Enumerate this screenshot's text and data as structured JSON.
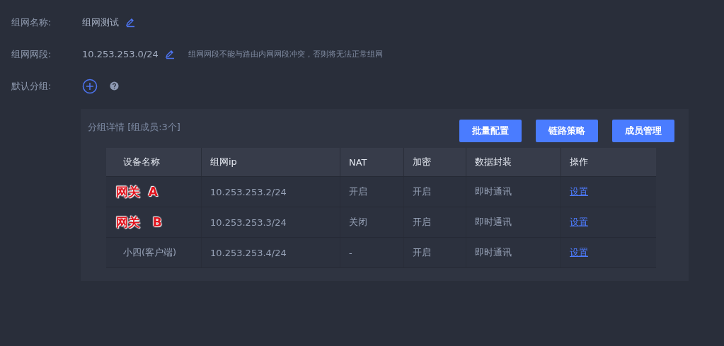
{
  "fields": [
    {
      "label": "组网名称:",
      "value": "组网测试",
      "editable": true
    },
    {
      "label": "组网网段:",
      "value": "10.253.253.0/24",
      "editable": true,
      "hint": "组网网段不能与路由内网网段冲突，否则将无法正常组网"
    }
  ],
  "default_group": {
    "label": "默认分组:"
  },
  "group_panel": {
    "title": "分组详情 [组成员:3个]",
    "buttons": [
      "批量配置",
      "链路策略",
      "成员管理"
    ],
    "table": {
      "columns": [
        "设备名称",
        "组网ip",
        "NAT",
        "加密",
        "数据封装",
        "操作"
      ],
      "rows": [
        {
          "name": "网关  A",
          "kind": "annotated",
          "ip": "10.253.253.2/24",
          "nat": "开启",
          "encryption": "开启",
          "encapsulation": "即时通讯",
          "action": "设置"
        },
        {
          "name": "网关   B",
          "kind": "annotated",
          "ip": "10.253.253.3/24",
          "nat": "关闭",
          "encryption": "开启",
          "encapsulation": "即时通讯",
          "action": "设置"
        },
        {
          "name": "小四(客户端)",
          "kind": "plain",
          "ip": "10.253.253.4/24",
          "nat": "-",
          "encryption": "开启",
          "encapsulation": "即时通讯",
          "action": "设置"
        }
      ]
    }
  }
}
